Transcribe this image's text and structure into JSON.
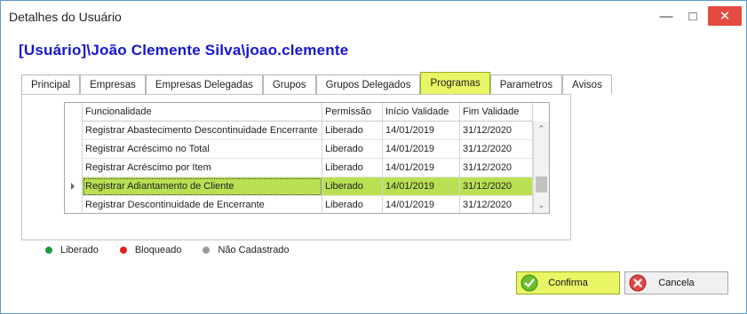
{
  "window": {
    "title": "Detalhes do Usuário"
  },
  "header": {
    "user_path": "[Usuário]\\João Clemente Silva\\joao.clemente"
  },
  "tabs": [
    {
      "label": "Principal"
    },
    {
      "label": "Empresas"
    },
    {
      "label": "Empresas Delegadas"
    },
    {
      "label": "Grupos"
    },
    {
      "label": "Grupos Delegados"
    },
    {
      "label": "Programas"
    },
    {
      "label": "Parametros"
    },
    {
      "label": "Avisos"
    }
  ],
  "active_tab": "Programas",
  "grid": {
    "columns": [
      "Funcionalidade",
      "Permissão",
      "Início Validade",
      "Fim Validade"
    ],
    "rows": [
      [
        "Registrar Abastecimento Descontinuidade Encerrante",
        "Liberado",
        "14/01/2019",
        "31/12/2020"
      ],
      [
        "Registrar Acréscimo no Total",
        "Liberado",
        "14/01/2019",
        "31/12/2020"
      ],
      [
        "Registrar Acréscimo por Item",
        "Liberado",
        "14/01/2019",
        "31/12/2020"
      ],
      [
        "Registrar Adiantamento de Cliente",
        "Liberado",
        "14/01/2019",
        "31/12/2020"
      ],
      [
        "Registrar Descontinuidade de Encerrante",
        "Liberado",
        "14/01/2019",
        "31/12/2020"
      ]
    ],
    "selected_row_index": 3
  },
  "legend": [
    {
      "label": "Liberado",
      "color": "#1a9a3a"
    },
    {
      "label": "Bloqueado",
      "color": "#e02020"
    },
    {
      "label": "Não Cadastrado",
      "color": "#9a9a9a"
    }
  ],
  "buttons": {
    "confirm": {
      "label": "Confirma",
      "icon": "check-icon"
    },
    "cancel": {
      "label": "Cancela",
      "icon": "close-circle-icon"
    }
  },
  "colors": {
    "accent": "#e8f564",
    "selection": "#b9e052",
    "title_blue": "#1515d6"
  }
}
